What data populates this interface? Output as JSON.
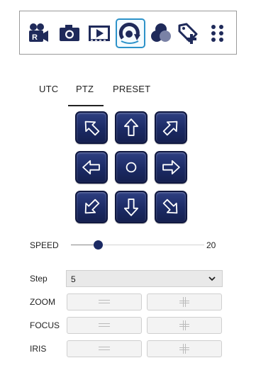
{
  "toolbar": {
    "icons": [
      {
        "name": "record-camera-icon"
      },
      {
        "name": "snapshot-camera-icon"
      },
      {
        "name": "playback-icon"
      },
      {
        "name": "ptz-control-icon"
      },
      {
        "name": "color-adjust-icon"
      },
      {
        "name": "add-tag-icon"
      },
      {
        "name": "more-grid-icon"
      }
    ],
    "active_color": "#2c92c9",
    "icon_color": "#1f2a5a"
  },
  "tabs": [
    {
      "label": "UTC"
    },
    {
      "label": "PTZ",
      "active": true
    },
    {
      "label": "PRESET"
    }
  ],
  "pad": {
    "buttons": [
      "up-left",
      "up",
      "up-right",
      "left",
      "center",
      "right",
      "down-left",
      "down",
      "down-right"
    ],
    "color": "#1b2a64"
  },
  "speed": {
    "label": "SPEED",
    "value": "20"
  },
  "step": {
    "label": "Step",
    "value": "5"
  },
  "controls": [
    {
      "label": "ZOOM"
    },
    {
      "label": "FOCUS"
    },
    {
      "label": "IRIS"
    }
  ]
}
